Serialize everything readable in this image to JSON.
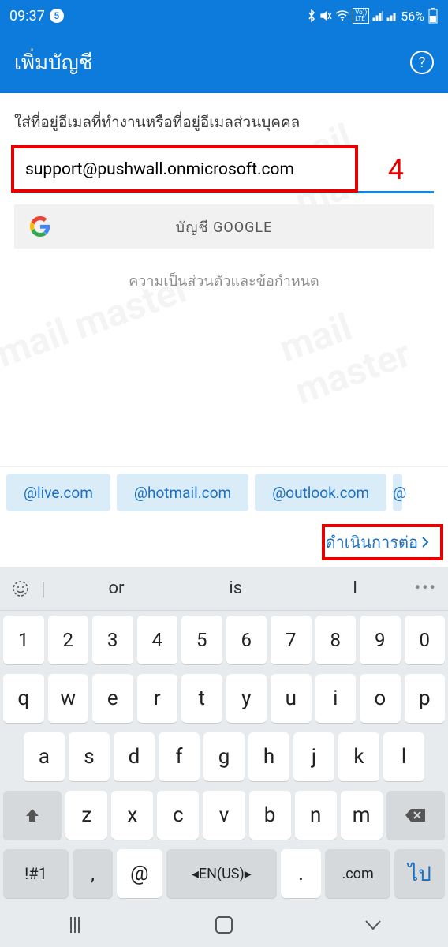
{
  "status": {
    "time": "09:37",
    "notif_count": "5",
    "battery": "56%"
  },
  "header": {
    "title": "เพิ่มบัญชี"
  },
  "main": {
    "prompt": "ใส่ที่อยู่อีเมลที่ทำงานหรือที่อยู่อีเมลส่วนบุคคล",
    "email_value": "support@pushwall.onmicrosoft.com",
    "google_label": "บัญชี GOOGLE",
    "privacy_label": "ความเป็นส่วนตัวและข้อกำหนด",
    "annotation_number": "4"
  },
  "suggestions": [
    "@live.com",
    "@hotmail.com",
    "@outlook.com",
    "@"
  ],
  "continue_label": "ดำเนินการต่อ",
  "keyboard": {
    "predictions": [
      "or",
      "is",
      "I"
    ],
    "row_num": [
      "1",
      "2",
      "3",
      "4",
      "5",
      "6",
      "7",
      "8",
      "9",
      "0"
    ],
    "row1": [
      "q",
      "w",
      "e",
      "r",
      "t",
      "y",
      "u",
      "i",
      "o",
      "p"
    ],
    "row2": [
      "a",
      "s",
      "d",
      "f",
      "g",
      "h",
      "j",
      "k",
      "l"
    ],
    "row3": [
      "z",
      "x",
      "c",
      "v",
      "b",
      "n",
      "m"
    ],
    "sym": "!#1",
    "comma": ",",
    "at": "@",
    "lang": "EN(US)",
    "dot": ".",
    "com": ".com",
    "go": "ไป"
  }
}
